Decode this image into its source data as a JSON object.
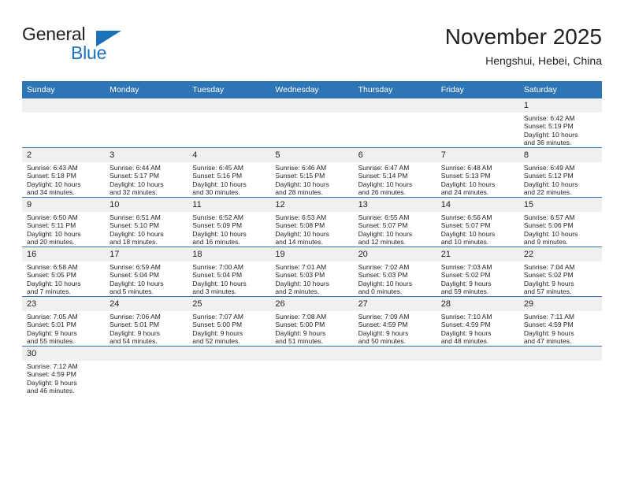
{
  "brand": {
    "name_top": "General",
    "name_bottom": "Blue",
    "accent_color": "#1b72b8"
  },
  "header": {
    "title": "November 2025",
    "subtitle": "Hengshui, Hebei, China"
  },
  "theme": {
    "header_blue": "#2e75b6",
    "daynum_band": "#f0f0f0",
    "text": "#231f20"
  },
  "weekdays": [
    "Sunday",
    "Monday",
    "Tuesday",
    "Wednesday",
    "Thursday",
    "Friday",
    "Saturday"
  ],
  "weeks": [
    [
      {
        "day": "",
        "sunrise": "",
        "sunset": "",
        "daylight1": "",
        "daylight2": ""
      },
      {
        "day": "",
        "sunrise": "",
        "sunset": "",
        "daylight1": "",
        "daylight2": ""
      },
      {
        "day": "",
        "sunrise": "",
        "sunset": "",
        "daylight1": "",
        "daylight2": ""
      },
      {
        "day": "",
        "sunrise": "",
        "sunset": "",
        "daylight1": "",
        "daylight2": ""
      },
      {
        "day": "",
        "sunrise": "",
        "sunset": "",
        "daylight1": "",
        "daylight2": ""
      },
      {
        "day": "",
        "sunrise": "",
        "sunset": "",
        "daylight1": "",
        "daylight2": ""
      },
      {
        "day": "1",
        "sunrise": "Sunrise: 6:42 AM",
        "sunset": "Sunset: 5:19 PM",
        "daylight1": "Daylight: 10 hours",
        "daylight2": "and 36 minutes."
      }
    ],
    [
      {
        "day": "2",
        "sunrise": "Sunrise: 6:43 AM",
        "sunset": "Sunset: 5:18 PM",
        "daylight1": "Daylight: 10 hours",
        "daylight2": "and 34 minutes."
      },
      {
        "day": "3",
        "sunrise": "Sunrise: 6:44 AM",
        "sunset": "Sunset: 5:17 PM",
        "daylight1": "Daylight: 10 hours",
        "daylight2": "and 32 minutes."
      },
      {
        "day": "4",
        "sunrise": "Sunrise: 6:45 AM",
        "sunset": "Sunset: 5:16 PM",
        "daylight1": "Daylight: 10 hours",
        "daylight2": "and 30 minutes."
      },
      {
        "day": "5",
        "sunrise": "Sunrise: 6:46 AM",
        "sunset": "Sunset: 5:15 PM",
        "daylight1": "Daylight: 10 hours",
        "daylight2": "and 28 minutes."
      },
      {
        "day": "6",
        "sunrise": "Sunrise: 6:47 AM",
        "sunset": "Sunset: 5:14 PM",
        "daylight1": "Daylight: 10 hours",
        "daylight2": "and 26 minutes."
      },
      {
        "day": "7",
        "sunrise": "Sunrise: 6:48 AM",
        "sunset": "Sunset: 5:13 PM",
        "daylight1": "Daylight: 10 hours",
        "daylight2": "and 24 minutes."
      },
      {
        "day": "8",
        "sunrise": "Sunrise: 6:49 AM",
        "sunset": "Sunset: 5:12 PM",
        "daylight1": "Daylight: 10 hours",
        "daylight2": "and 22 minutes."
      }
    ],
    [
      {
        "day": "9",
        "sunrise": "Sunrise: 6:50 AM",
        "sunset": "Sunset: 5:11 PM",
        "daylight1": "Daylight: 10 hours",
        "daylight2": "and 20 minutes."
      },
      {
        "day": "10",
        "sunrise": "Sunrise: 6:51 AM",
        "sunset": "Sunset: 5:10 PM",
        "daylight1": "Daylight: 10 hours",
        "daylight2": "and 18 minutes."
      },
      {
        "day": "11",
        "sunrise": "Sunrise: 6:52 AM",
        "sunset": "Sunset: 5:09 PM",
        "daylight1": "Daylight: 10 hours",
        "daylight2": "and 16 minutes."
      },
      {
        "day": "12",
        "sunrise": "Sunrise: 6:53 AM",
        "sunset": "Sunset: 5:08 PM",
        "daylight1": "Daylight: 10 hours",
        "daylight2": "and 14 minutes."
      },
      {
        "day": "13",
        "sunrise": "Sunrise: 6:55 AM",
        "sunset": "Sunset: 5:07 PM",
        "daylight1": "Daylight: 10 hours",
        "daylight2": "and 12 minutes."
      },
      {
        "day": "14",
        "sunrise": "Sunrise: 6:56 AM",
        "sunset": "Sunset: 5:07 PM",
        "daylight1": "Daylight: 10 hours",
        "daylight2": "and 10 minutes."
      },
      {
        "day": "15",
        "sunrise": "Sunrise: 6:57 AM",
        "sunset": "Sunset: 5:06 PM",
        "daylight1": "Daylight: 10 hours",
        "daylight2": "and 9 minutes."
      }
    ],
    [
      {
        "day": "16",
        "sunrise": "Sunrise: 6:58 AM",
        "sunset": "Sunset: 5:05 PM",
        "daylight1": "Daylight: 10 hours",
        "daylight2": "and 7 minutes."
      },
      {
        "day": "17",
        "sunrise": "Sunrise: 6:59 AM",
        "sunset": "Sunset: 5:04 PM",
        "daylight1": "Daylight: 10 hours",
        "daylight2": "and 5 minutes."
      },
      {
        "day": "18",
        "sunrise": "Sunrise: 7:00 AM",
        "sunset": "Sunset: 5:04 PM",
        "daylight1": "Daylight: 10 hours",
        "daylight2": "and 3 minutes."
      },
      {
        "day": "19",
        "sunrise": "Sunrise: 7:01 AM",
        "sunset": "Sunset: 5:03 PM",
        "daylight1": "Daylight: 10 hours",
        "daylight2": "and 2 minutes."
      },
      {
        "day": "20",
        "sunrise": "Sunrise: 7:02 AM",
        "sunset": "Sunset: 5:03 PM",
        "daylight1": "Daylight: 10 hours",
        "daylight2": "and 0 minutes."
      },
      {
        "day": "21",
        "sunrise": "Sunrise: 7:03 AM",
        "sunset": "Sunset: 5:02 PM",
        "daylight1": "Daylight: 9 hours",
        "daylight2": "and 59 minutes."
      },
      {
        "day": "22",
        "sunrise": "Sunrise: 7:04 AM",
        "sunset": "Sunset: 5:02 PM",
        "daylight1": "Daylight: 9 hours",
        "daylight2": "and 57 minutes."
      }
    ],
    [
      {
        "day": "23",
        "sunrise": "Sunrise: 7:05 AM",
        "sunset": "Sunset: 5:01 PM",
        "daylight1": "Daylight: 9 hours",
        "daylight2": "and 55 minutes."
      },
      {
        "day": "24",
        "sunrise": "Sunrise: 7:06 AM",
        "sunset": "Sunset: 5:01 PM",
        "daylight1": "Daylight: 9 hours",
        "daylight2": "and 54 minutes."
      },
      {
        "day": "25",
        "sunrise": "Sunrise: 7:07 AM",
        "sunset": "Sunset: 5:00 PM",
        "daylight1": "Daylight: 9 hours",
        "daylight2": "and 52 minutes."
      },
      {
        "day": "26",
        "sunrise": "Sunrise: 7:08 AM",
        "sunset": "Sunset: 5:00 PM",
        "daylight1": "Daylight: 9 hours",
        "daylight2": "and 51 minutes."
      },
      {
        "day": "27",
        "sunrise": "Sunrise: 7:09 AM",
        "sunset": "Sunset: 4:59 PM",
        "daylight1": "Daylight: 9 hours",
        "daylight2": "and 50 minutes."
      },
      {
        "day": "28",
        "sunrise": "Sunrise: 7:10 AM",
        "sunset": "Sunset: 4:59 PM",
        "daylight1": "Daylight: 9 hours",
        "daylight2": "and 48 minutes."
      },
      {
        "day": "29",
        "sunrise": "Sunrise: 7:11 AM",
        "sunset": "Sunset: 4:59 PM",
        "daylight1": "Daylight: 9 hours",
        "daylight2": "and 47 minutes."
      }
    ],
    [
      {
        "day": "30",
        "sunrise": "Sunrise: 7:12 AM",
        "sunset": "Sunset: 4:59 PM",
        "daylight1": "Daylight: 9 hours",
        "daylight2": "and 46 minutes."
      },
      {
        "day": "",
        "sunrise": "",
        "sunset": "",
        "daylight1": "",
        "daylight2": ""
      },
      {
        "day": "",
        "sunrise": "",
        "sunset": "",
        "daylight1": "",
        "daylight2": ""
      },
      {
        "day": "",
        "sunrise": "",
        "sunset": "",
        "daylight1": "",
        "daylight2": ""
      },
      {
        "day": "",
        "sunrise": "",
        "sunset": "",
        "daylight1": "",
        "daylight2": ""
      },
      {
        "day": "",
        "sunrise": "",
        "sunset": "",
        "daylight1": "",
        "daylight2": ""
      },
      {
        "day": "",
        "sunrise": "",
        "sunset": "",
        "daylight1": "",
        "daylight2": ""
      }
    ]
  ]
}
